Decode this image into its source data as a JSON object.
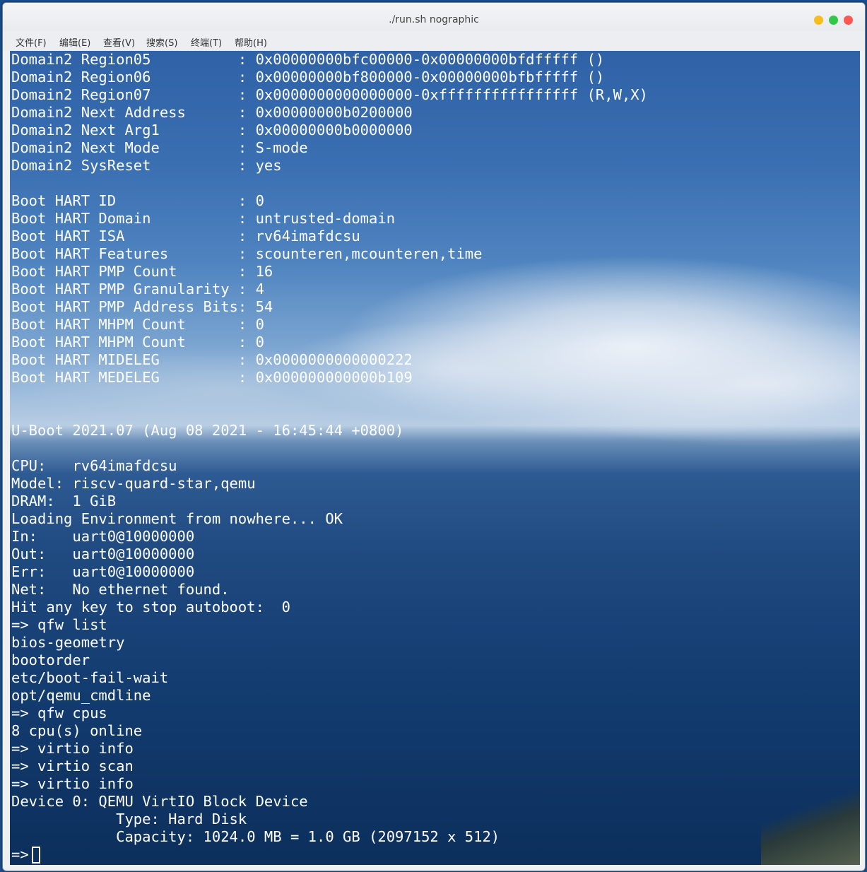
{
  "window": {
    "title": "./run.sh nographic",
    "controls": {
      "minimize_color": "#f6bd1d",
      "maximize_color": "#33c748",
      "close_color": "#fc5753"
    }
  },
  "menubar": {
    "items": [
      "文件(F)",
      "编辑(E)",
      "查看(V)",
      "搜索(S)",
      "终端(T)",
      "帮助(H)"
    ]
  },
  "terminal": {
    "lines": [
      "Domain2 Region05          : 0x00000000bfc00000-0x00000000bfdfffff ()",
      "Domain2 Region06          : 0x00000000bf800000-0x00000000bfbfffff ()",
      "Domain2 Region07          : 0x0000000000000000-0xffffffffffffffff (R,W,X)",
      "Domain2 Next Address      : 0x00000000b0200000",
      "Domain2 Next Arg1         : 0x00000000b0000000",
      "Domain2 Next Mode         : S-mode",
      "Domain2 SysReset          : yes",
      "",
      "Boot HART ID              : 0",
      "Boot HART Domain          : untrusted-domain",
      "Boot HART ISA             : rv64imafdcsu",
      "Boot HART Features        : scounteren,mcounteren,time",
      "Boot HART PMP Count       : 16",
      "Boot HART PMP Granularity : 4",
      "Boot HART PMP Address Bits: 54",
      "Boot HART MHPM Count      : 0",
      "Boot HART MHPM Count      : 0",
      "Boot HART MIDELEG         : 0x0000000000000222",
      "Boot HART MEDELEG         : 0x000000000000b109",
      "",
      "",
      "U-Boot 2021.07 (Aug 08 2021 - 16:45:44 +0800)",
      "",
      "CPU:   rv64imafdcsu",
      "Model: riscv-quard-star,qemu",
      "DRAM:  1 GiB",
      "Loading Environment from nowhere... OK",
      "In:    uart0@10000000",
      "Out:   uart0@10000000",
      "Err:   uart0@10000000",
      "Net:   No ethernet found.",
      "Hit any key to stop autoboot:  0",
      "=> qfw list",
      "bios-geometry",
      "bootorder",
      "etc/boot-fail-wait",
      "opt/qemu_cmdline",
      "=> qfw cpus",
      "8 cpu(s) online",
      "=> virtio info",
      "=> virtio scan",
      "=> virtio info",
      "Device 0: QEMU VirtIO Block Device",
      "            Type: Hard Disk",
      "            Capacity: 1024.0 MB = 1.0 GB (2097152 x 512)"
    ],
    "prompt": "=>"
  }
}
